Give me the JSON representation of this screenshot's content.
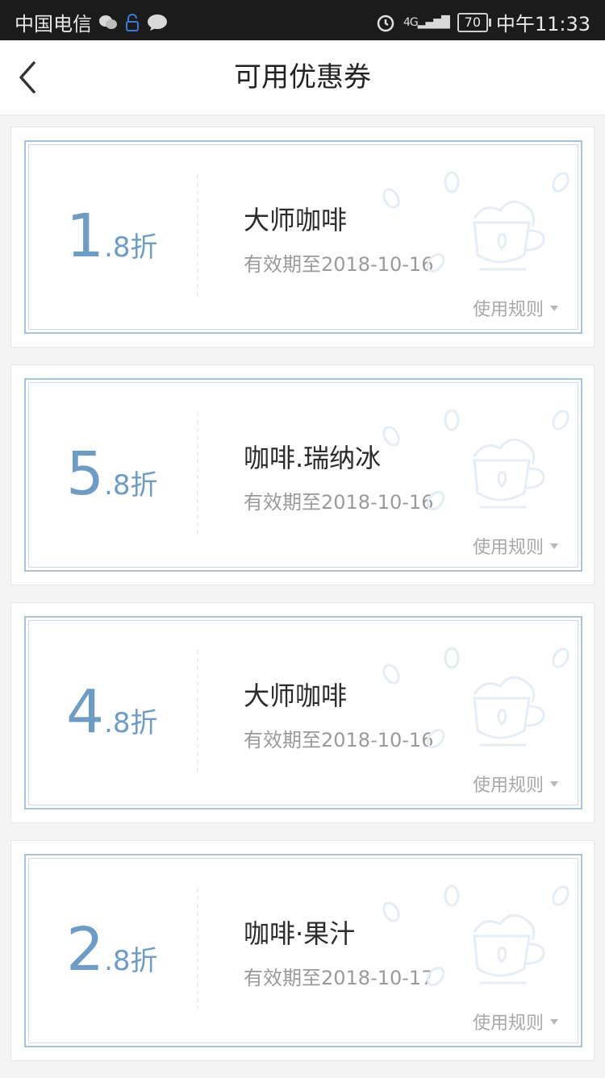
{
  "status_bar": {
    "carrier": "中国电信",
    "time": "中午11:33",
    "battery": "70",
    "network": "4G"
  },
  "nav": {
    "title": "可用优惠券"
  },
  "coupons": [
    {
      "integer": "1",
      "fraction": ".8折",
      "name": "大师咖啡",
      "expiry": "有效期至2018-10-16",
      "rules_label": "使用规则"
    },
    {
      "integer": "5",
      "fraction": ".8折",
      "name": "咖啡.瑞纳冰",
      "expiry": "有效期至2018-10-16",
      "rules_label": "使用规则"
    },
    {
      "integer": "4",
      "fraction": ".8折",
      "name": "大师咖啡",
      "expiry": "有效期至2018-10-16",
      "rules_label": "使用规则"
    },
    {
      "integer": "2",
      "fraction": ".8折",
      "name": "咖啡·果汁",
      "expiry": "有效期至2018-10-17",
      "rules_label": "使用规则"
    }
  ],
  "colors": {
    "accent": "#6f9cc4",
    "border": "#a9c2d6"
  }
}
